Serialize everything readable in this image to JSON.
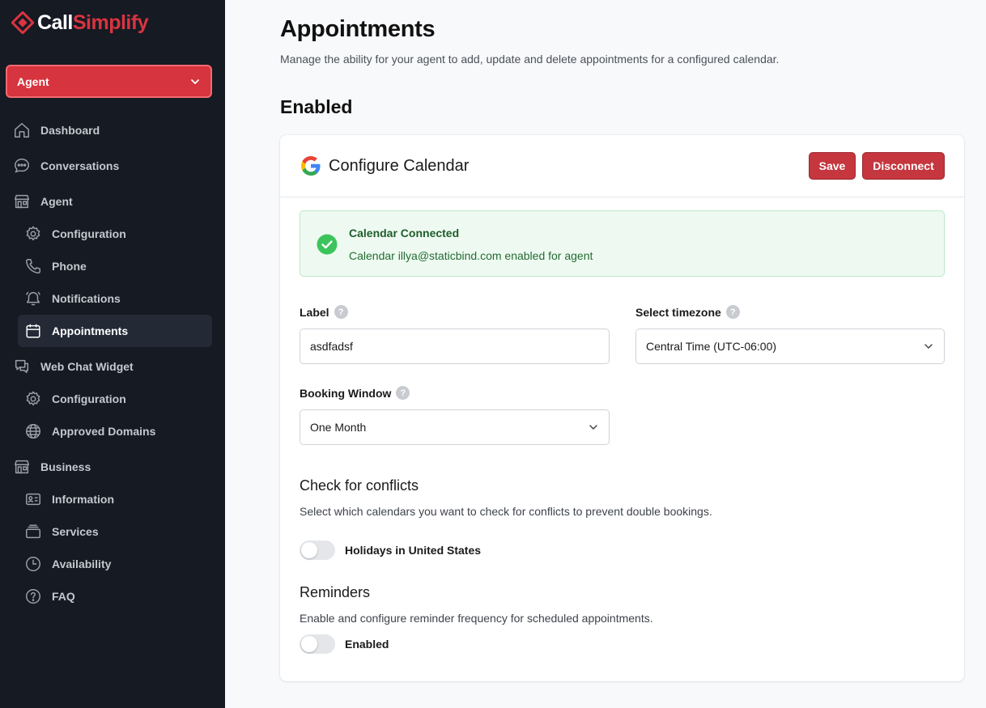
{
  "brand": {
    "part1": "Call",
    "part2": "Simplify",
    "accent": "#d6343e"
  },
  "agent_select": {
    "value": "Agent"
  },
  "nav": {
    "dashboard": "Dashboard",
    "conversations": "Conversations",
    "agent": "Agent",
    "agent_configuration": "Configuration",
    "phone": "Phone",
    "notifications": "Notifications",
    "appointments": "Appointments",
    "web_chat_widget": "Web Chat Widget",
    "widget_configuration": "Configuration",
    "approved_domains": "Approved Domains",
    "business": "Business",
    "information": "Information",
    "services": "Services",
    "availability": "Availability",
    "faq": "FAQ"
  },
  "page": {
    "title": "Appointments",
    "subtitle": "Manage the ability for your agent to add, update and delete appointments for a configured calendar.",
    "section": "Enabled"
  },
  "card": {
    "title": "Configure Calendar",
    "save": "Save",
    "disconnect": "Disconnect",
    "alert_title": "Calendar Connected",
    "alert_text": "Calendar illya@staticbind.com enabled for agent",
    "label_label": "Label",
    "label_value": "asdfadsf",
    "timezone_label": "Select timezone",
    "timezone_value": "Central Time (UTC-06:00)",
    "booking_label": "Booking Window",
    "booking_value": "One Month",
    "conflicts_title": "Check for conflicts",
    "conflicts_desc": "Select which calendars you want to check for conflicts to prevent double bookings.",
    "holidays_label": "Holidays in United States",
    "reminders_title": "Reminders",
    "reminders_desc": "Enable and configure reminder frequency for scheduled appointments.",
    "reminders_toggle_label": "Enabled",
    "help_glyph": "?"
  }
}
